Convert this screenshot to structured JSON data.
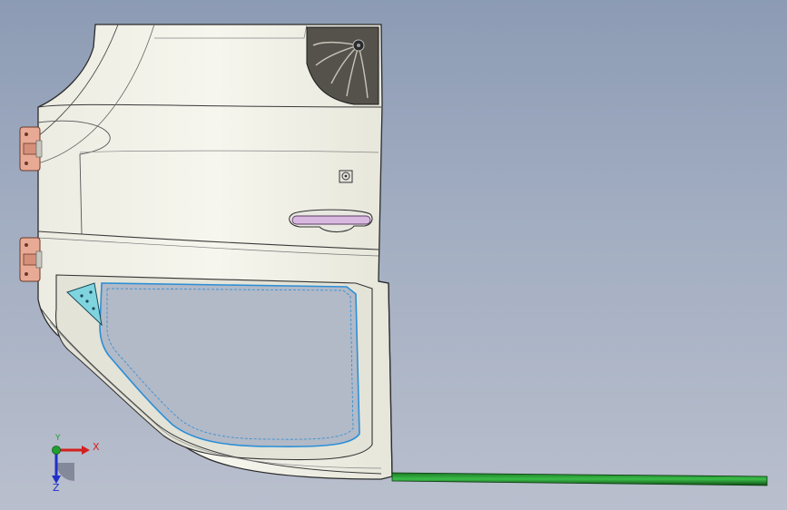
{
  "viewport": {
    "background_top": "#8c9bb4",
    "background_bottom": "#b9bfcd"
  },
  "model": {
    "panel_color": "#f3f3ea",
    "edge_color": "#2b2b2b",
    "hinge_color": "#e8aa95",
    "handle_color": "#d9b8e0",
    "bracket_color": "#7fd4e0",
    "glass_edge_color": "#2c8fd6",
    "seal_color": "#1f8a2a"
  },
  "triad": {
    "x_label": "X",
    "y_label": "Y",
    "z_label": "Z",
    "x_color": "#d42020",
    "y_color": "#20a030",
    "z_color": "#2030c8"
  }
}
